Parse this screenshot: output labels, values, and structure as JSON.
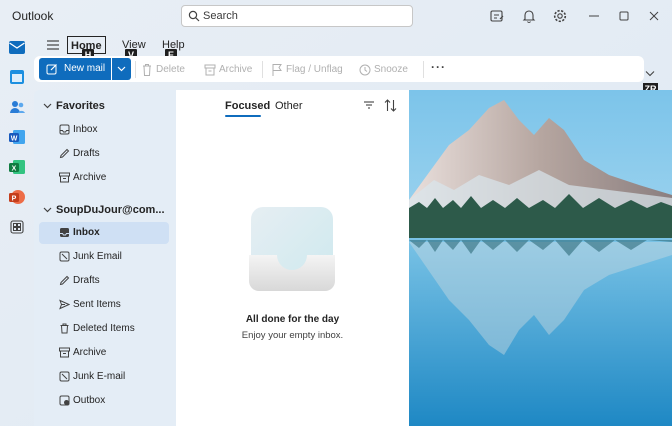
{
  "app": {
    "title": "Outlook"
  },
  "search": {
    "placeholder": "Search"
  },
  "titlebar_icons": [
    "compose-note-icon",
    "bell-icon",
    "gear-icon",
    "minimize-icon",
    "maximize-icon",
    "close-icon"
  ],
  "rail": [
    "mail-icon",
    "calendar-icon",
    "people-icon",
    "word-icon",
    "excel-icon",
    "powerpoint-icon",
    "apps-icon"
  ],
  "ribbon_tabs": [
    {
      "label": "Home",
      "keytip": "H"
    },
    {
      "label": "View",
      "keytip": "V"
    },
    {
      "label": "Help",
      "keytip": "E"
    }
  ],
  "ribbon": {
    "new_mail": "New mail",
    "delete": "Delete",
    "archive": "Archive",
    "flag": "Flag / Unflag",
    "snooze": "Snooze",
    "more": "···",
    "expand_keytip": "ZR"
  },
  "favorites": {
    "header": "Favorites",
    "items": [
      {
        "label": "Inbox",
        "icon": "inbox-icon"
      },
      {
        "label": "Drafts",
        "icon": "pencil-icon"
      },
      {
        "label": "Archive",
        "icon": "archive-icon"
      }
    ]
  },
  "account": {
    "header": "SoupDuJour@com...",
    "items": [
      {
        "label": "Inbox",
        "icon": "inbox-icon",
        "selected": true
      },
      {
        "label": "Junk Email",
        "icon": "junk-icon"
      },
      {
        "label": "Drafts",
        "icon": "pencil-icon"
      },
      {
        "label": "Sent Items",
        "icon": "send-icon"
      },
      {
        "label": "Deleted Items",
        "icon": "trash-icon"
      },
      {
        "label": "Archive",
        "icon": "archive-icon"
      },
      {
        "label": "Junk E-mail",
        "icon": "junk-icon"
      },
      {
        "label": "Outbox",
        "icon": "outbox-icon"
      }
    ]
  },
  "message_list": {
    "tabs": [
      "Focused",
      "Other"
    ],
    "active_tab": "Focused",
    "empty_title": "All done for the day",
    "empty_subtitle": "Enjoy your empty inbox."
  },
  "colors": {
    "accent": "#0f6cbd",
    "selected": "#cfe0f4",
    "pane": "#e4edf6"
  }
}
